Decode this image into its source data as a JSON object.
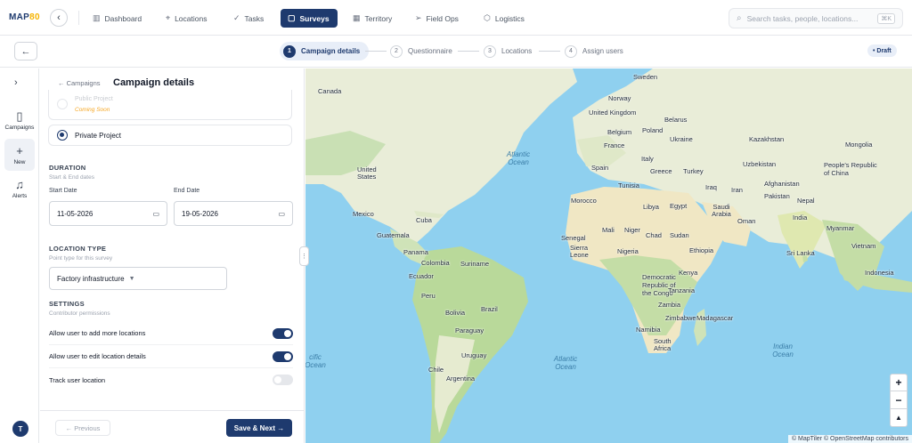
{
  "brand": {
    "logo_main": "MAP",
    "logo_accent": "80"
  },
  "nav": {
    "items": [
      {
        "label": "Dashboard"
      },
      {
        "label": "Locations"
      },
      {
        "label": "Tasks"
      },
      {
        "label": "Surveys"
      },
      {
        "label": "Territory"
      },
      {
        "label": "Field Ops"
      },
      {
        "label": "Logistics"
      }
    ],
    "active": "Surveys"
  },
  "search": {
    "placeholder": "Search tasks, people, locations...",
    "shortcut": "⌘K"
  },
  "stepper": {
    "steps": [
      {
        "num": "1",
        "label": "Campaign details"
      },
      {
        "num": "2",
        "label": "Questionnaire"
      },
      {
        "num": "3",
        "label": "Locations"
      },
      {
        "num": "4",
        "label": "Assign users"
      }
    ],
    "status": "• Draft"
  },
  "rail": {
    "items": [
      {
        "label": "Campaigns"
      },
      {
        "label": "New"
      },
      {
        "label": "Alerts"
      }
    ],
    "avatar": "T"
  },
  "panel": {
    "breadcrumb": "← Campaigns",
    "title": "Campaign details",
    "public_label": "Public Project",
    "public_note": "Coming Soon",
    "private_label": "Private Project",
    "duration": {
      "title": "DURATION",
      "sub": "Start & End dates",
      "start_label": "Start Date",
      "start_value": "11-05-2026",
      "end_label": "End Date",
      "end_value": "19-05-2026"
    },
    "location_type": {
      "title": "LOCATION TYPE",
      "sub": "Point type for this survey",
      "value": "Factory infrastructure"
    },
    "settings": {
      "title": "SETTINGS",
      "sub": "Contributor permissions",
      "toggles": [
        {
          "label": "Allow user to add more locations",
          "on": true
        },
        {
          "label": "Allow user to edit location details",
          "on": true
        },
        {
          "label": "Track user location",
          "on": false
        }
      ]
    },
    "prev_label": "← Previous",
    "next_label": "Save & Next →"
  },
  "map": {
    "countries": [
      "Canada",
      "Sweden",
      "Norway",
      "United Kingdom",
      "Belarus",
      "Belgium",
      "Poland",
      "Ukraine",
      "France",
      "Kazakhstan",
      "Mongolia",
      "Italy",
      "Spain",
      "Greece",
      "Turkey",
      "Uzbekistan",
      "People's Republic of China",
      "United States",
      "Tunisia",
      "Iraq",
      "Iran",
      "Afghanistan",
      "Morocco",
      "Libya",
      "Egypt",
      "Saudi Arabia",
      "Pakistan",
      "Nepal",
      "Mexico",
      "Cuba",
      "Oman",
      "India",
      "Guatemala",
      "Mali",
      "Niger",
      "Chad",
      "Sudan",
      "Senegal",
      "Sierra Leone",
      "Nigeria",
      "Ethiopia",
      "Myanmar",
      "Vietnam",
      "Panama",
      "Colombia",
      "Suriname",
      "Ecuador",
      "Sri Lanka",
      "Kenya",
      "Democratic Republic of the Congo",
      "Indonesia",
      "Peru",
      "Brazil",
      "Tanzania",
      "Bolivia",
      "Zambia",
      "Zimbabwe",
      "Madagascar",
      "Paraguay",
      "Namibia",
      "South Africa",
      "Chile",
      "Uruguay",
      "Argentina"
    ],
    "oceans": [
      "Atlantic Ocean",
      "Atlantic Ocean",
      "Indian Ocean",
      "cific Ocean"
    ],
    "zoom_in": "+",
    "zoom_out": "−",
    "compass": "▲",
    "attribution": "© MapTiler © OpenStreetMap contributors"
  }
}
